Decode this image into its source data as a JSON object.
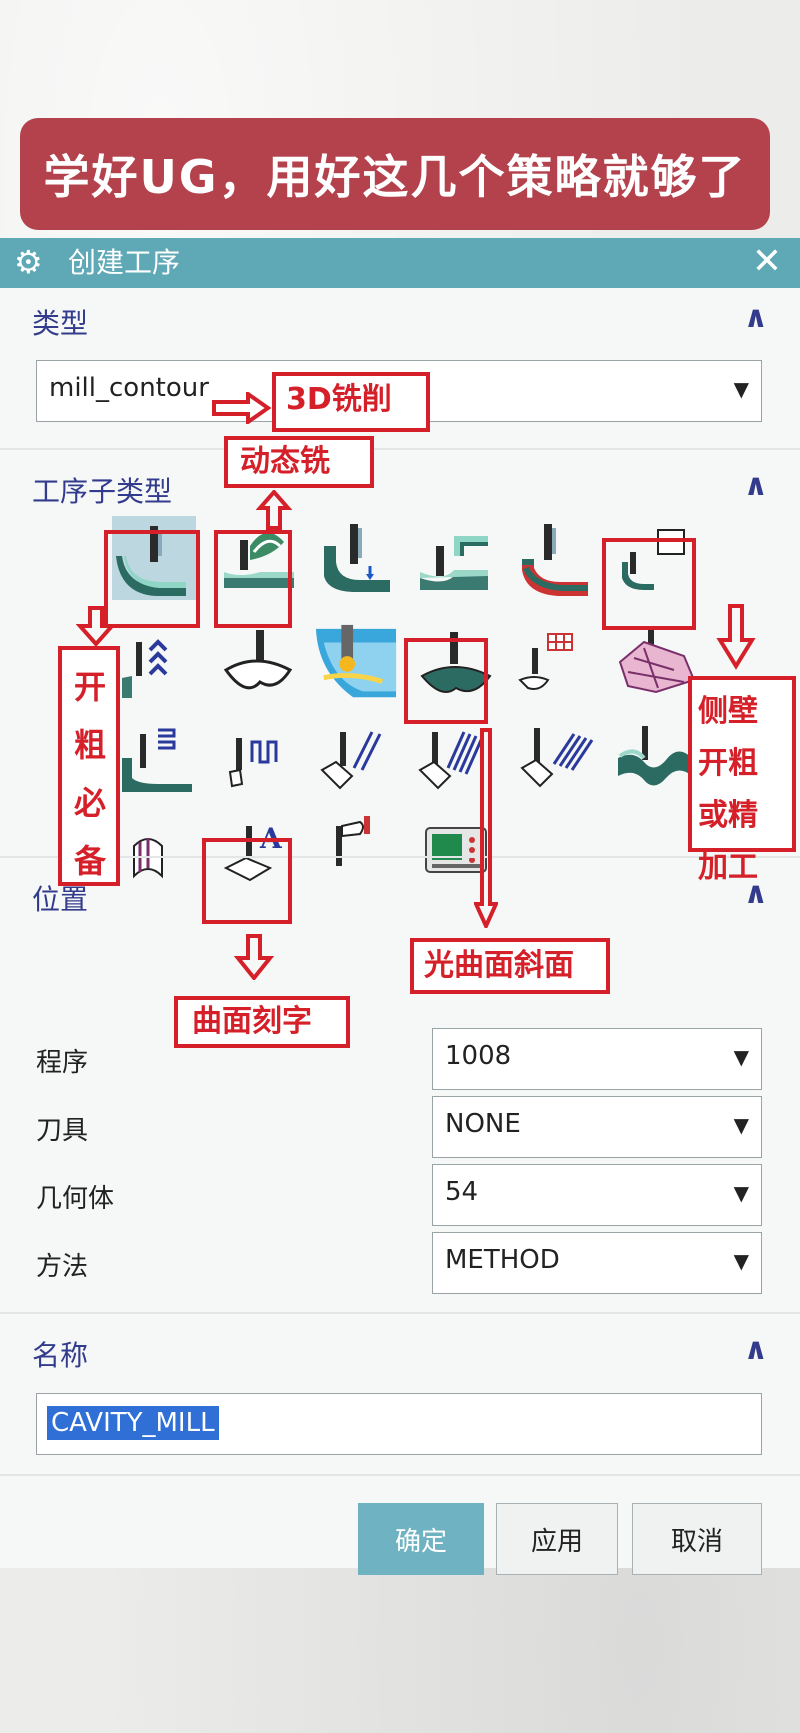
{
  "banner": "学好UG，用好这几个策略就够了",
  "dialog": {
    "title": "创建工序",
    "type_section": {
      "label": "类型",
      "value": "mill_contour"
    },
    "subtype_section": {
      "label": "工序子类型"
    },
    "location_section": {
      "label": "位置",
      "rows": [
        {
          "label": "程序",
          "value": "1008"
        },
        {
          "label": "刀具",
          "value": "NONE"
        },
        {
          "label": "几何体",
          "value": "54"
        },
        {
          "label": "方法",
          "value": "METHOD"
        }
      ]
    },
    "name_section": {
      "label": "名称",
      "value": "CAVITY_MILL"
    },
    "buttons": {
      "ok": "确定",
      "apply": "应用",
      "cancel": "取消"
    }
  },
  "annotations": {
    "3d_mill": "3D铣削",
    "dynamic_mill": "动态铣",
    "rough_essential": "开粗必备",
    "sidewall": "侧壁开粗或精加工",
    "smooth_surface": "光曲面斜面",
    "engrave": "曲面刻字"
  },
  "colors": {
    "titlebar": "#5fa8b6",
    "banner": "#b3424d",
    "annotation_red": "#d5202a",
    "section_label": "#333c8c"
  }
}
